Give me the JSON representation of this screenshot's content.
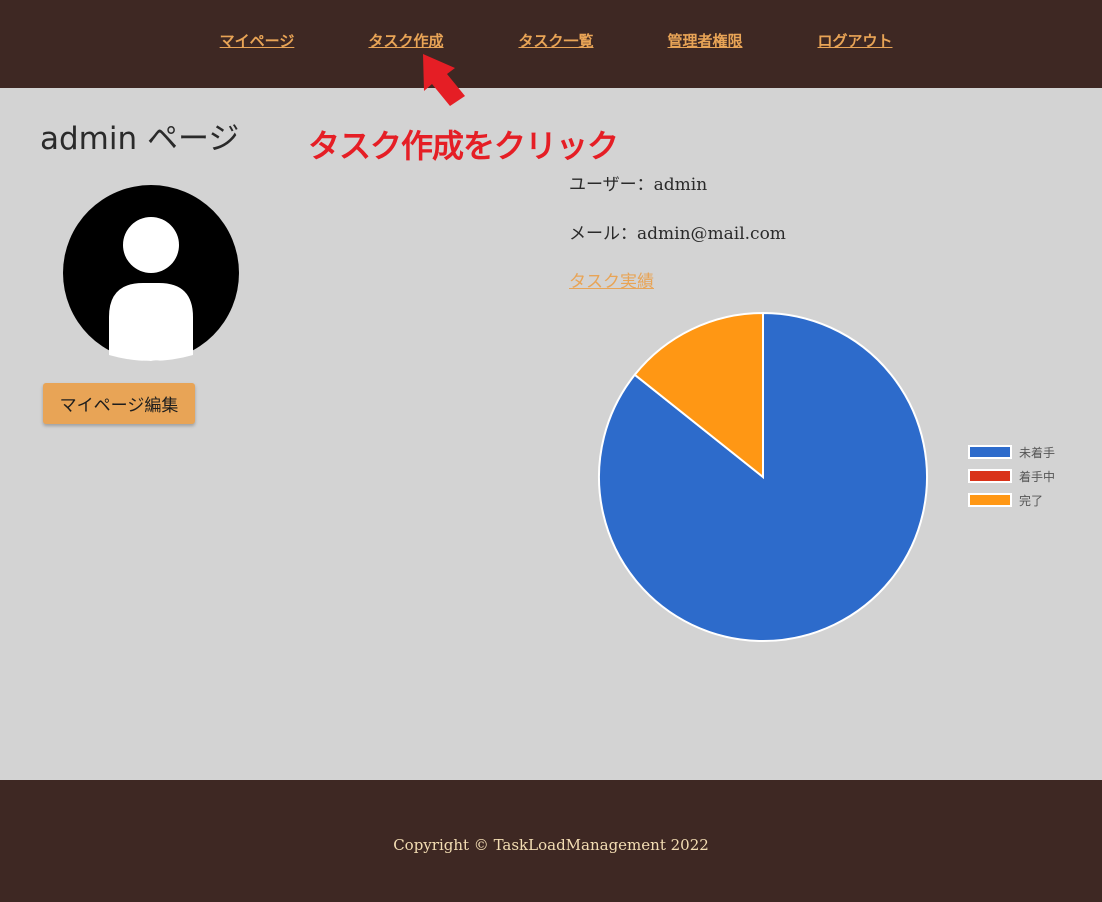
{
  "nav": {
    "items": [
      {
        "label": "マイページ"
      },
      {
        "label": "タスク作成"
      },
      {
        "label": "タスク一覧"
      },
      {
        "label": "管理者権限"
      },
      {
        "label": "ログアウト"
      }
    ]
  },
  "annotation": {
    "text": "タスク作成をクリック",
    "color": "#e51e25",
    "icon": "arrow-up-left-icon"
  },
  "profile": {
    "title": "admin ページ",
    "avatar_icon": "user-avatar-icon",
    "edit_button": "マイページ編集"
  },
  "info": {
    "user": "ユーザー：admin",
    "mail": "メール：admin@mail.com",
    "results_link": "タスク実績"
  },
  "chart_data": {
    "type": "pie",
    "categories": [
      "未着手",
      "着手中",
      "完了"
    ],
    "values": [
      6,
      0,
      1
    ],
    "colors": [
      "#2d6bcb",
      "#d9331a",
      "#ff9714"
    ],
    "legend_position": "right"
  },
  "footer": {
    "copyright": "Copyright © TaskLoadManagement 2022"
  },
  "colors": {
    "header_bg": "#3e2823",
    "main_bg": "#d3d3d3",
    "accent": "#e8a456"
  }
}
